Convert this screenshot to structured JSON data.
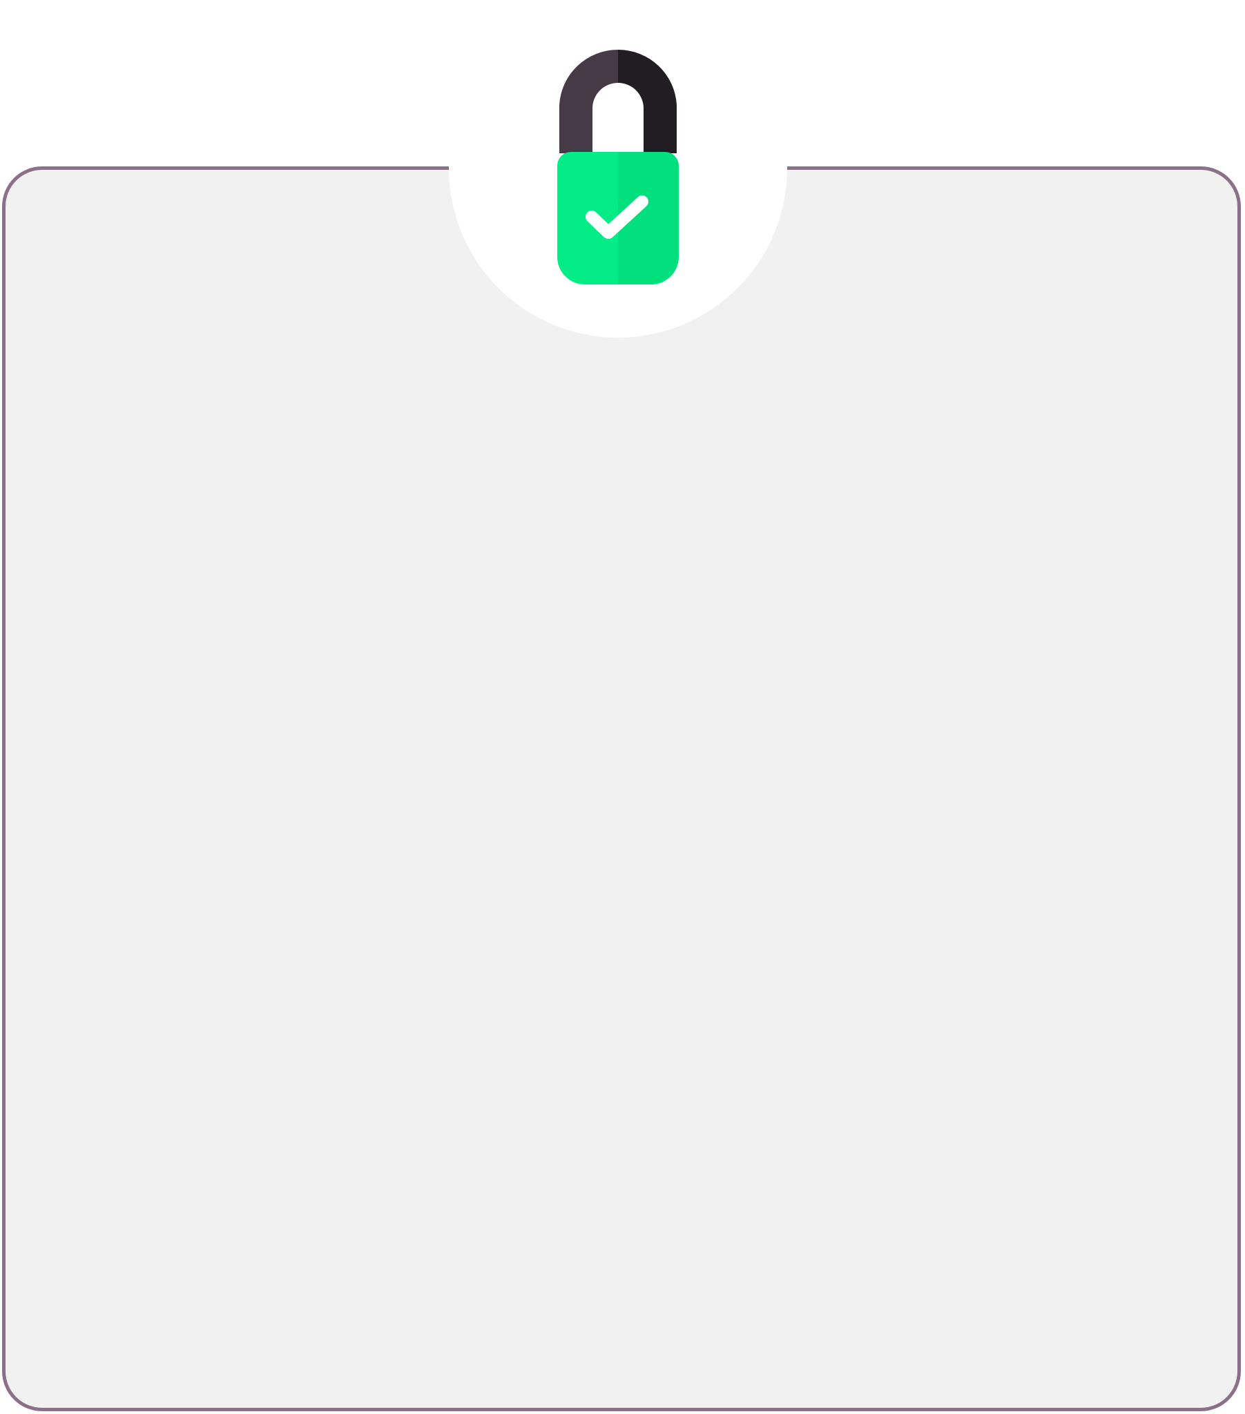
{
  "panel": {
    "background_color": "#f1f1f1",
    "border_color": "#8c7089"
  },
  "badge": {
    "background_color": "#ffffff"
  },
  "lock": {
    "icon": "lock-check-icon",
    "shackle_color_light": "#463a47",
    "shackle_color_dark": "#211d22",
    "body_color_light": "#03ec86",
    "body_color_dark": "#02df7d",
    "check_color": "#ffffff"
  }
}
